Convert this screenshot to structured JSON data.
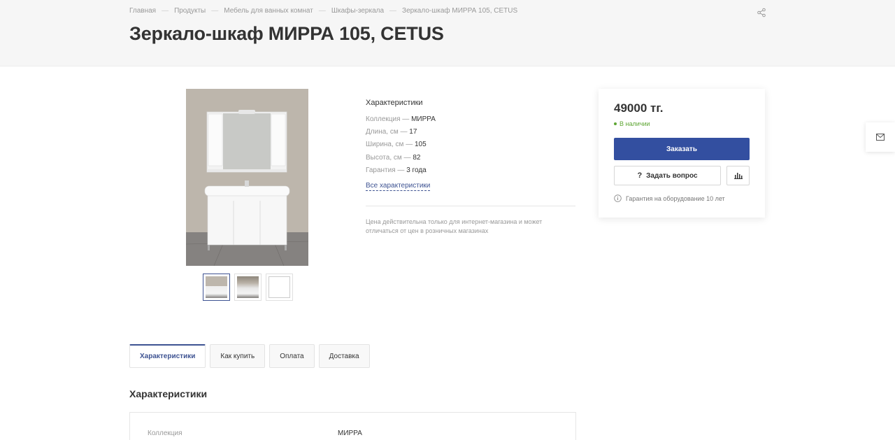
{
  "breadcrumb": [
    "Главная",
    "Продукты",
    "Мебель для ванных комнат",
    "Шкафы-зеркала",
    "Зеркало-шкаф МИРРА 105, CETUS"
  ],
  "page_title": "Зеркало-шкаф МИРРА 105, CETUS",
  "icons": {
    "share": "share-icon",
    "mail": "mail-icon",
    "question": "question-icon",
    "compare": "bar-chart-icon",
    "info": "info-icon"
  },
  "specs": {
    "title": "Характеристики",
    "rows": [
      {
        "label": "Коллекция —",
        "value": "МИРРА"
      },
      {
        "label": "Длина, см —",
        "value": "17"
      },
      {
        "label": "Ширина, см —",
        "value": "105"
      },
      {
        "label": "Высота, см —",
        "value": "82"
      },
      {
        "label": "Гарантия —",
        "value": "3 года"
      }
    ],
    "all_link": "Все характеристики",
    "price_note": "Цена действительна только для интернет-магазина и может отличаться от цен в розничных магазинах"
  },
  "buy": {
    "price": "49000 тг.",
    "stock": "В наличии",
    "order_button": "Заказать",
    "ask_button": "Задать вопрос",
    "warranty": "Гарантия на оборудование 10 лет"
  },
  "tabs": [
    "Характеристики",
    "Как купить",
    "Оплата",
    "Доставка"
  ],
  "section_title": "Характеристики",
  "table": {
    "label": "Коллекция",
    "value": "МИРРА"
  },
  "colors": {
    "accent": "#334fa0",
    "in_stock": "#5ea634"
  }
}
